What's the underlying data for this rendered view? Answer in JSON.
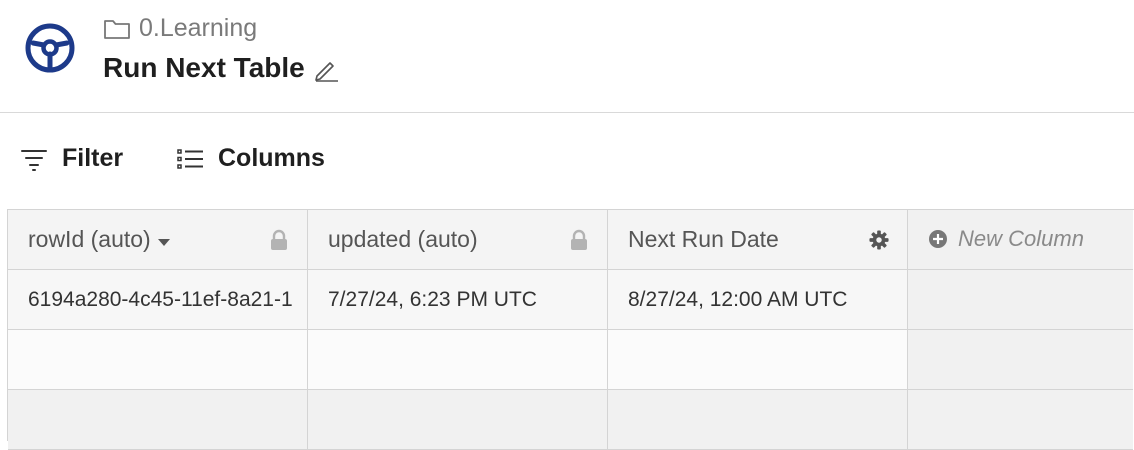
{
  "header": {
    "breadcrumb_folder": "0.Learning",
    "title": "Run Next Table"
  },
  "toolbar": {
    "filter_label": "Filter",
    "columns_label": "Columns"
  },
  "table": {
    "columns": [
      {
        "label": "rowId (auto)",
        "icon": "lock-icon"
      },
      {
        "label": "updated (auto)",
        "icon": "lock-icon"
      },
      {
        "label": "Next Run Date",
        "icon": "gear-icon"
      }
    ],
    "new_column_label": "New Column",
    "rows": [
      [
        "6194a280-4c45-11ef-8a21-1",
        "7/27/24, 6:23 PM UTC",
        "8/27/24, 12:00 AM UTC"
      ]
    ]
  },
  "colors": {
    "brand": "#1d3a8a",
    "border": "#d4d4d4",
    "header_bg": "#f4f4f4"
  }
}
